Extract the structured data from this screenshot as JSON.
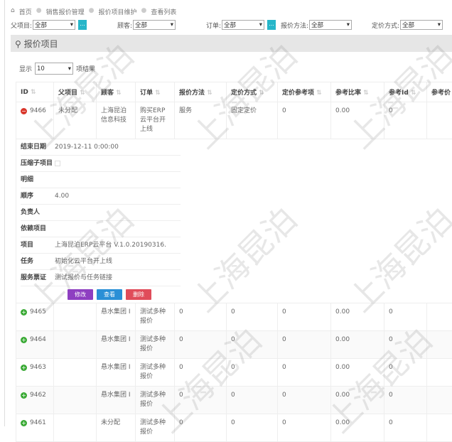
{
  "breadcrumb": [
    "首页",
    "销售报价管理",
    "报价项目维护",
    "查看列表"
  ],
  "filters": [
    {
      "label": "父项目:",
      "value": "全部",
      "has_picker": true
    },
    {
      "label": "顾客:",
      "value": "全部",
      "has_picker": false
    },
    {
      "label": "订单:",
      "value": "全部",
      "has_picker": true
    },
    {
      "label": "报价方法:",
      "value": "全部",
      "has_picker": false
    },
    {
      "label": "定价方式:",
      "value": "全部",
      "has_picker": false
    }
  ],
  "picker_label": "...",
  "panel_title": "报价项目",
  "page_size": {
    "prefix": "显示",
    "value": "10",
    "suffix": "项结果"
  },
  "columns": [
    "ID",
    "父项目",
    "顾客",
    "订单",
    "报价方法",
    "定价方式",
    "定价参考项",
    "参考比率",
    "参考Id",
    "参考价"
  ],
  "expanded_row": {
    "id": "9466",
    "cells": [
      "未分配",
      "上海昆泊信息科技",
      "购买ERP云平台开上线",
      "服务",
      "固定定价",
      "0",
      "0.00",
      "0",
      ""
    ]
  },
  "details": [
    {
      "k": "结束日期",
      "v": "2019-12-11 0:00:00"
    },
    {
      "k": "压缩子项目",
      "v": "",
      "checkbox": true
    },
    {
      "k": "明细",
      "v": ""
    },
    {
      "k": "顺序",
      "v": "4.00"
    },
    {
      "k": "负责人",
      "v": ""
    },
    {
      "k": "依赖项目",
      "v": ""
    },
    {
      "k": "项目",
      "v": "上海昆泊ERP云平台 V.1.0.20190316."
    },
    {
      "k": "任务",
      "v": "初始化云平台开上线"
    },
    {
      "k": "服务票证",
      "v": "测试报价与任务链接"
    }
  ],
  "actions": [
    {
      "label": "修改",
      "color": "#8e3fc1"
    },
    {
      "label": "查看",
      "color": "#2a8fd6"
    },
    {
      "label": "删除",
      "color": "#e04c5a"
    }
  ],
  "rows": [
    {
      "id": "9465",
      "cells": [
        "",
        "悬水集团 I",
        "测试多种报价",
        "0",
        "0",
        "0",
        "0.00",
        "0",
        ""
      ]
    },
    {
      "id": "9464",
      "cells": [
        "",
        "悬水集团 I",
        "测试多种报价",
        "0",
        "0",
        "0",
        "0.00",
        "0",
        ""
      ]
    },
    {
      "id": "9463",
      "cells": [
        "",
        "悬水集团 I",
        "测试多种报价",
        "0",
        "0",
        "0",
        "0.00",
        "0",
        ""
      ]
    },
    {
      "id": "9462",
      "cells": [
        "",
        "悬水集团 I",
        "测试多种报价",
        "0",
        "0",
        "0",
        "0.00",
        "0",
        ""
      ]
    },
    {
      "id": "9461",
      "cells": [
        "",
        "未分配",
        "测试多种报价",
        "0",
        "0",
        "0",
        "0.00",
        "0",
        ""
      ]
    }
  ],
  "watermark": "上海昆泊"
}
